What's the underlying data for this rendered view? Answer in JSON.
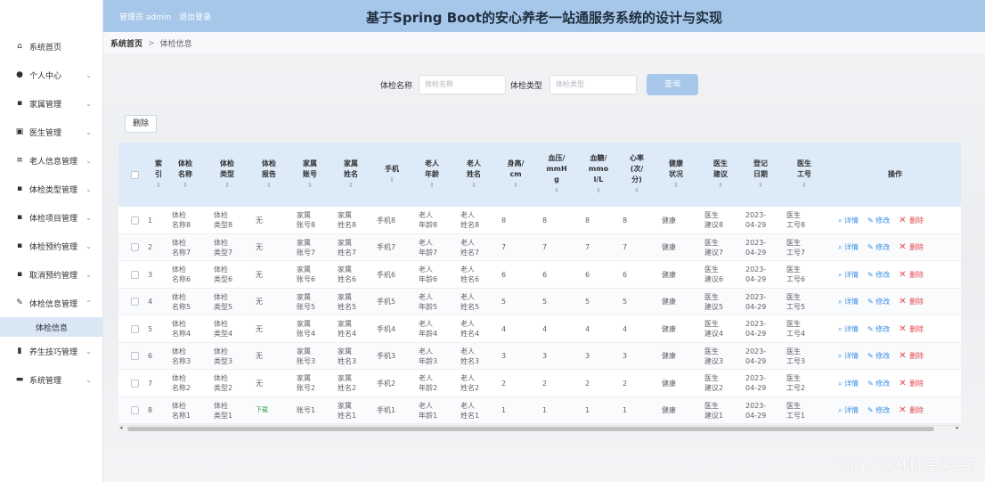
{
  "header": {
    "admin_label": "管理员 admin",
    "logout_label": "退出登录",
    "title": "基于Spring Boot的安心养老一站通服务系统的设计与实现"
  },
  "breadcrumb": {
    "home": "系统首页",
    "separator": ">",
    "current": "体检信息"
  },
  "sidebar": {
    "items": [
      {
        "icon": "home-icon",
        "label": "系统首页",
        "chevron": false
      },
      {
        "icon": "user-icon",
        "label": "个人中心",
        "chevron": true
      },
      {
        "icon": "grid-icon",
        "label": "家属管理",
        "chevron": true
      },
      {
        "icon": "doctor-icon",
        "label": "医生管理",
        "chevron": true
      },
      {
        "icon": "list-icon",
        "label": "老人信息管理",
        "chevron": true
      },
      {
        "icon": "grid-icon",
        "label": "体检类型管理",
        "chevron": true
      },
      {
        "icon": "grid-icon",
        "label": "体检项目管理",
        "chevron": true
      },
      {
        "icon": "grid-icon",
        "label": "体检预约管理",
        "chevron": true
      },
      {
        "icon": "grid-icon",
        "label": "取消预约管理",
        "chevron": true
      },
      {
        "icon": "edit-icon",
        "label": "体检信息管理",
        "chevron": true,
        "expanded": true
      },
      {
        "icon": "chart-icon",
        "label": "养生技巧管理",
        "chevron": true
      },
      {
        "icon": "system-icon",
        "label": "系统管理",
        "chevron": true
      }
    ],
    "sub_item": "体检信息"
  },
  "search": {
    "name_label": "体检名称",
    "name_placeholder": "体检名称",
    "type_label": "体检类型",
    "type_placeholder": "体检类型",
    "query_button": "查询"
  },
  "toolbar": {
    "delete_label": "删除"
  },
  "table": {
    "headers": [
      "索\n引",
      "体检\n名称",
      "体检\n类型",
      "体检\n报告",
      "家属\n账号",
      "家属\n姓名",
      "手机",
      "老人\n年龄",
      "老人\n姓名",
      "身高/\ncm",
      "血压/\nmmH\ng",
      "血糖/\nmmo\nl/L",
      "心率\n(次/\n分)",
      "健康\n状况",
      "医生\n建议",
      "登记\n日期",
      "医生\n工号",
      "操作"
    ],
    "ops": {
      "detail": "详情",
      "edit": "修改",
      "delete": "删除"
    },
    "rows": [
      [
        "1",
        "体检\n名称8",
        "体检\n类型8",
        "无",
        "家属\n账号8",
        "家属\n姓名8",
        "手机8",
        "老人\n年龄8",
        "老人\n姓名8",
        "8",
        "8",
        "8",
        "8",
        "健康",
        "医生\n建议8",
        "2023-\n04-29",
        "医生\n工号8"
      ],
      [
        "2",
        "体检\n名称7",
        "体检\n类型7",
        "无",
        "家属\n账号7",
        "家属\n姓名7",
        "手机7",
        "老人\n年龄7",
        "老人\n姓名7",
        "7",
        "7",
        "7",
        "7",
        "健康",
        "医生\n建议7",
        "2023-\n04-29",
        "医生\n工号7"
      ],
      [
        "3",
        "体检\n名称6",
        "体检\n类型6",
        "无",
        "家属\n账号6",
        "家属\n姓名6",
        "手机6",
        "老人\n年龄6",
        "老人\n姓名6",
        "6",
        "6",
        "6",
        "6",
        "健康",
        "医生\n建议6",
        "2023-\n04-29",
        "医生\n工号6"
      ],
      [
        "4",
        "体检\n名称5",
        "体检\n类型5",
        "无",
        "家属\n账号5",
        "家属\n姓名5",
        "手机5",
        "老人\n年龄5",
        "老人\n姓名5",
        "5",
        "5",
        "5",
        "5",
        "健康",
        "医生\n建议5",
        "2023-\n04-29",
        "医生\n工号5"
      ],
      [
        "5",
        "体检\n名称4",
        "体检\n类型4",
        "无",
        "家属\n账号4",
        "家属\n姓名4",
        "手机4",
        "老人\n年龄4",
        "老人\n姓名4",
        "4",
        "4",
        "4",
        "4",
        "健康",
        "医生\n建议4",
        "2023-\n04-29",
        "医生\n工号4"
      ],
      [
        "6",
        "体检\n名称3",
        "体检\n类型3",
        "无",
        "家属\n账号3",
        "家属\n姓名3",
        "手机3",
        "老人\n年龄3",
        "老人\n姓名3",
        "3",
        "3",
        "3",
        "3",
        "健康",
        "医生\n建议3",
        "2023-\n04-29",
        "医生\n工号3"
      ],
      [
        "7",
        "体检\n名称2",
        "体检\n类型2",
        "无",
        "家属\n账号2",
        "家属\n姓名2",
        "手机2",
        "老人\n年龄2",
        "老人\n姓名2",
        "2",
        "2",
        "2",
        "2",
        "健康",
        "医生\n建议2",
        "2023-\n04-29",
        "医生\n工号2"
      ],
      [
        "8",
        "体检\n名称1",
        "体检\n类型1",
        "下载",
        "账号1",
        "家属\n姓名1",
        "手机1",
        "老人\n年龄1",
        "老人\n姓名1",
        "1",
        "1",
        "1",
        "1",
        "健康",
        "医生\n建议1",
        "2023-\n04-29",
        "医生\n工号1"
      ]
    ]
  },
  "watermark": "CSDN @林科程序设计",
  "colors": {
    "header_bg": "#a7c7ea",
    "table_header_bg": "#ddeaf7",
    "link": "#3a8ee6",
    "danger": "#e5484d"
  }
}
